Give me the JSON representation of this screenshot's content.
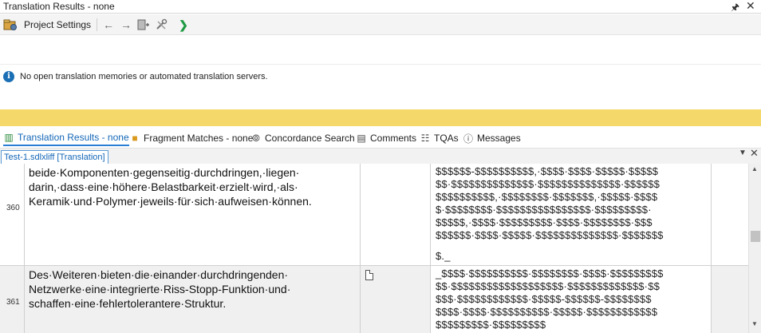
{
  "window": {
    "title": "Translation Results - none"
  },
  "toolbar": {
    "project_settings_label": "Project Settings"
  },
  "info": {
    "message": "No open translation memories or automated translation servers."
  },
  "tabs": [
    {
      "label": "Translation Results - none",
      "icon": "translation-results-icon",
      "active": true
    },
    {
      "label": "Fragment Matches - none",
      "icon": "fragment-matches-icon",
      "active": false
    },
    {
      "label": "Concordance Search",
      "icon": "binoculars-icon",
      "active": false
    },
    {
      "label": "Comments",
      "icon": "comments-icon",
      "active": false
    },
    {
      "label": "TQAs",
      "icon": "tqa-icon",
      "active": false
    },
    {
      "label": "Messages",
      "icon": "messages-icon",
      "active": false
    }
  ],
  "document": {
    "tab_label": "Test-1.sdlxliff [Translation]"
  },
  "segments": [
    {
      "number": "360",
      "source_lines": [
        "beide·Komponenten·gegenseitig·durchdringen,·liegen·",
        "darin,·dass·eine·höhere·Belastbarkeit·erzielt·wird,·als·",
        "Keramik·und·Polymer·jeweils·für·sich·aufweisen·können."
      ],
      "target_lines": [
        "$$$$$$-$$$$$$$$$$,·$$$$·$$$$·$$$$$·$$$$$",
        "$$·$$$$$$$$$$$$$$·$$$$$$$$$$$$$$·$$$$$$",
        "$$$$$$$$$$,·$$$$$$$$·$$$$$$$,·$$$$$·$$$$",
        "$·$$$$$$$$·$$$$$$$$$$$$$$$$·$$$$$$$$$·",
        "$$$$$,·$$$$·$$$$$$$$$·$$$$·$$$$$$$$·$$$",
        "$$$$$$·$$$$·$$$$$·$$$$$$$$$$$$$$·$$$$$$$",
        "$._"
      ]
    },
    {
      "number": "361",
      "source_lines": [
        "Des·Weiteren·bieten·die·einander·durchdringenden·",
        "Netzwerke·eine·integrierte·Riss-Stopp-Funktion·und·",
        "schaffen·eine·fehlertolerantere·Struktur."
      ],
      "target_lines": [
        "_$$$$·$$$$$$$$$$·$$$$$$$$·$$$$·$$$$$$$$$",
        "$$·$$$$$$$$$$$$$$$$$$$·$$$$$$$$$$$$$·$$",
        "$$$·$$$$$$$$$$$$·$$$$$-$$$$$$-$$$$$$$$",
        "$$$$·$$$$·$$$$$$$$$$·$$$$$·$$$$$$$$$$$$",
        "$$$$$$$$$·$$$$$$$$$"
      ]
    }
  ]
}
